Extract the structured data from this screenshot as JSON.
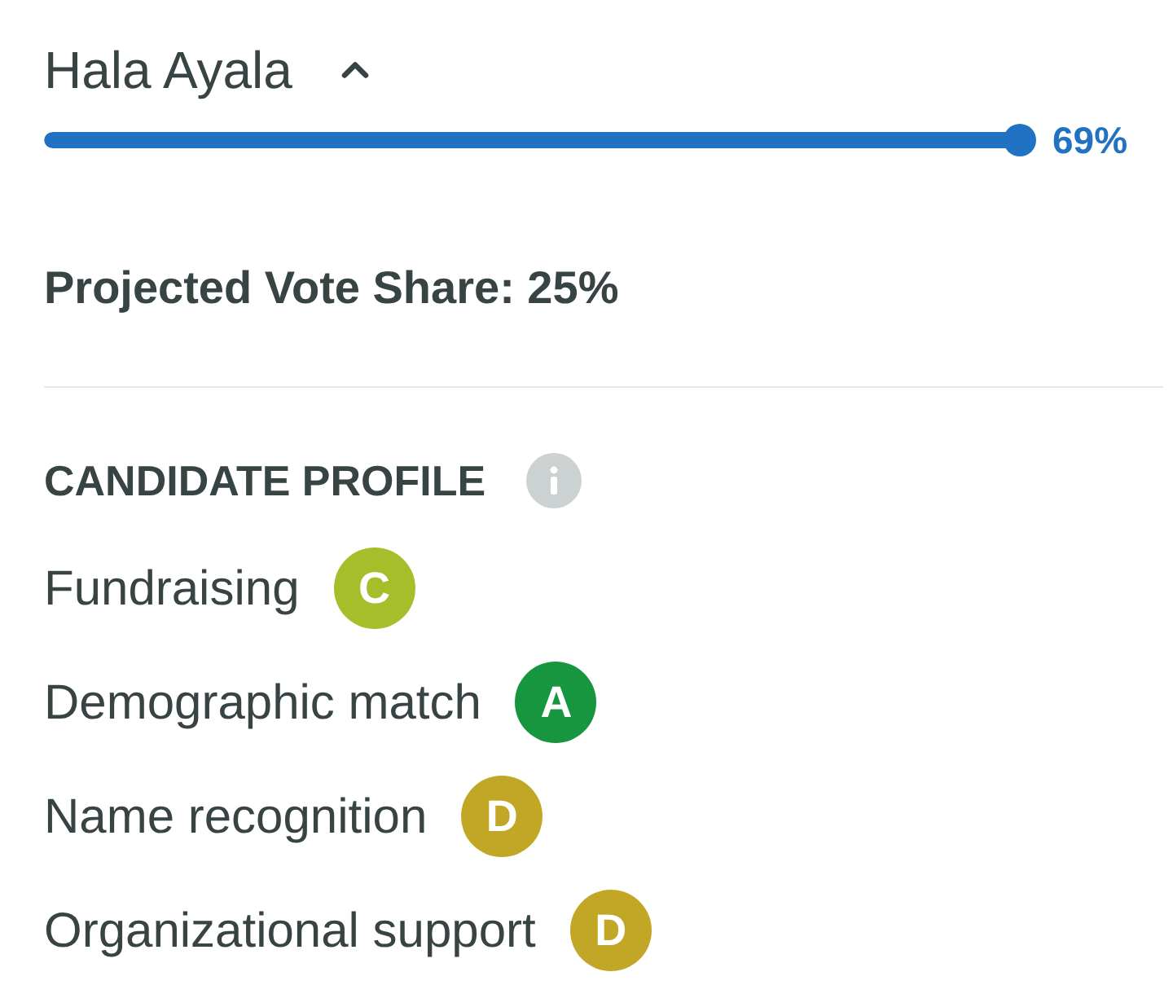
{
  "candidate": {
    "name": "Hala Ayala",
    "expanded": true,
    "bar": {
      "level": 1,
      "reading": "69%"
    }
  },
  "projected_vote_share": "Projected Vote Share: 25%",
  "profile": {
    "title": "CANDIDATE PROFILE",
    "rows": [
      {
        "label": "Fundraising",
        "grade": "C",
        "color": "#a6be2a"
      },
      {
        "label": "Demographic match",
        "grade": "A",
        "color": "#17963f"
      },
      {
        "label": "Name recognition",
        "grade": "D",
        "color": "#c2a626"
      },
      {
        "label": "Organizational support",
        "grade": "D",
        "color": "#c2a626"
      }
    ]
  }
}
